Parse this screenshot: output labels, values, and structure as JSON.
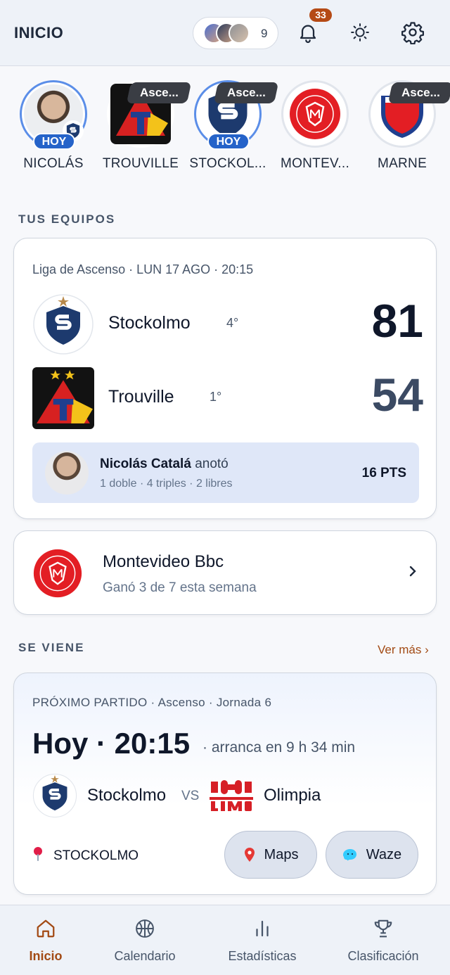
{
  "header": {
    "title": "INICIO",
    "followers_count": "9",
    "notifications_count": "33"
  },
  "stories": [
    {
      "name": "NICOLÁS",
      "tag": "HOY"
    },
    {
      "name": "TROUVILLE",
      "tag": "Asce..."
    },
    {
      "name": "STOCKOL...",
      "tag_top": "Asce...",
      "tag": "HOY"
    },
    {
      "name": "MONTEV..."
    },
    {
      "name": "MARNE",
      "tag": "Asce..."
    }
  ],
  "sections": {
    "tus_equipos": "TUS EQUIPOS",
    "se_viene": "SE VIENE",
    "ver_mas": "Ver más ›"
  },
  "match": {
    "meta": "Liga de Ascenso · LUN 17 AGO · 20:15",
    "home": {
      "name": "Stockolmo",
      "position": "4°",
      "score": "81"
    },
    "away": {
      "name": "Trouville",
      "position": "1°",
      "score": "54"
    },
    "scorer": {
      "name": "Nicolás Catalá",
      "verb": "anotó",
      "detail": "1 doble · 4 triples · 2 libres",
      "points": "16 PTS"
    }
  },
  "club": {
    "name": "Montevideo Bbc",
    "subtitle": "Ganó 3 de 7 esta semana"
  },
  "next_match": {
    "meta": "PRÓXIMO PARTIDO · Ascenso · Jornada 6",
    "time": "Hoy · 20:15",
    "eta": "· arranca en 9 h 34 min",
    "home": "Stockolmo",
    "vs": "VS",
    "away": "Olimpia",
    "venue": "STOCKOLMO",
    "maps_label": "Maps",
    "waze_label": "Waze"
  },
  "nav": [
    {
      "label": "Inicio",
      "active": true
    },
    {
      "label": "Calendario"
    },
    {
      "label": "Estadísticas"
    },
    {
      "label": "Clasificación"
    }
  ],
  "colors": {
    "accent": "#a24a14",
    "primary_blue": "#2563c9",
    "badge": "#b54a15"
  }
}
